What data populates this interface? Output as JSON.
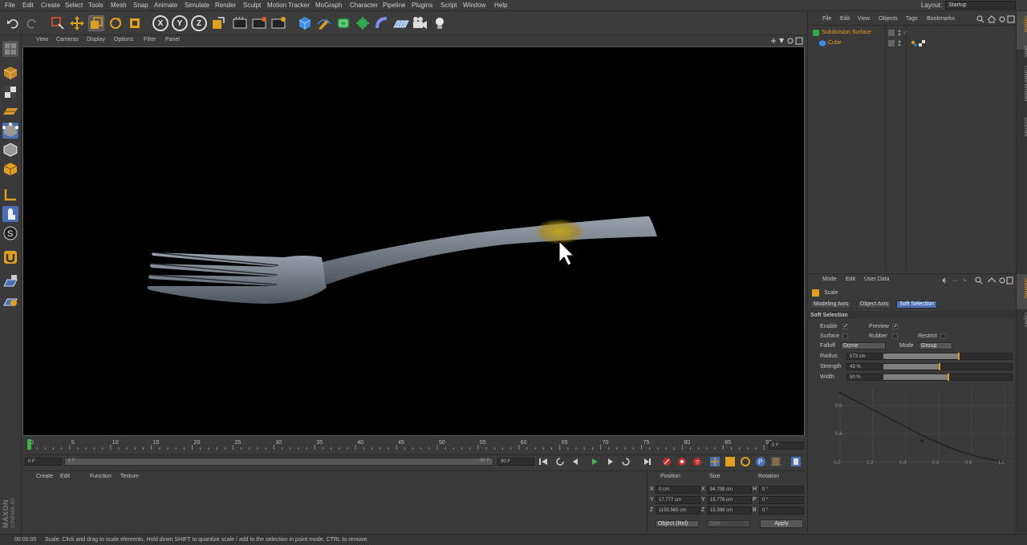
{
  "menu": [
    "File",
    "Edit",
    "Create",
    "Select",
    "Tools",
    "Mesh",
    "Snap",
    "Animate",
    "Simulate",
    "Render",
    "Sculpt",
    "Motion Tracker",
    "MoGraph",
    "Character",
    "Pipeline",
    "Plugins",
    "Script",
    "Window",
    "Help"
  ],
  "layout": {
    "label": "Layout:",
    "value": "Startup"
  },
  "toolbar_icons": [
    "undo-icon",
    "redo-icon",
    "live-selection-icon",
    "move-icon",
    "scale-icon",
    "rotate-icon",
    "recent-tool-icon",
    "x-axis-icon",
    "y-axis-icon",
    "z-axis-icon",
    "coordinate-system-icon",
    "render-view-icon",
    "render-picture-viewer-icon",
    "edit-render-settings-icon",
    "cube-icon",
    "pen-spline-icon",
    "subdivision-surface-icon",
    "array-icon",
    "deformer-icon",
    "floor-icon",
    "camera-icon",
    "light-icon"
  ],
  "axis_letters": {
    "x": "X",
    "y": "Y",
    "z": "Z"
  },
  "viewport_menu": [
    "View",
    "Cameras",
    "Display",
    "Options",
    "Filter",
    "Panel"
  ],
  "timeline": {
    "ticks": [
      "0",
      "5",
      "10",
      "15",
      "20",
      "25",
      "30",
      "35",
      "40",
      "45",
      "50",
      "55",
      "60",
      "65",
      "70",
      "75",
      "80",
      "85",
      "90"
    ],
    "end_field": "0 F",
    "current_frame": "0 F",
    "range_start": "0 F",
    "range_end": "90 F",
    "max_frame": "90 F"
  },
  "materials_menu": [
    "Create",
    "Edit",
    "Function",
    "Texture"
  ],
  "coords": {
    "headers": {
      "position": "Position",
      "size": "Size",
      "rotation": "Rotation"
    },
    "rows": [
      {
        "axis": "X",
        "pos": "0 cm",
        "size_axis": "X",
        "size": "94.708 cm",
        "rot_axis": "H",
        "rot": "0 °"
      },
      {
        "axis": "Y",
        "pos": "17.777 cm",
        "size_axis": "Y",
        "size": "15.778 cm",
        "rot_axis": "P",
        "rot": "0 °"
      },
      {
        "axis": "Z",
        "pos": "1150.565 cm",
        "size_axis": "Z",
        "size": "15.398 cm",
        "rot_axis": "B",
        "rot": "0 °"
      }
    ],
    "mode": "Object (Rel)",
    "size_mode": "Size",
    "apply": "Apply"
  },
  "maxon": {
    "brand": "MAXON",
    "product": "CINEMA 4D"
  },
  "status": {
    "time": "00:00:00",
    "message": "Scale: Click and drag to scale elements. Hold down SHIFT to quantize scale / add to the selection in point mode, CTRL to remove."
  },
  "object_manager": {
    "menu": [
      "File",
      "Edit",
      "View",
      "Objects",
      "Tags",
      "Bookmarks"
    ],
    "objects": [
      {
        "name": "Subdivision Surface",
        "color": "#e0a01e"
      },
      {
        "name": "Cube",
        "color": "#e0a01e"
      }
    ]
  },
  "right_tabs": [
    "Objects",
    "Takes",
    "Content Browser",
    "Structure"
  ],
  "right_tabs_lower": [
    "Attributes",
    "Layers"
  ],
  "attributes": {
    "menu": [
      "Mode",
      "Edit",
      "User Data"
    ],
    "tool_name": "Scale",
    "tabs": [
      "Modeling Axis",
      "Object Axis",
      "Soft Selection"
    ],
    "active_tab": "Soft Selection",
    "section": "Soft Selection",
    "enable": {
      "label": "Enable",
      "checked": true
    },
    "preview": {
      "label": "Preview",
      "checked": true
    },
    "surface": {
      "label": "Surface",
      "checked": false
    },
    "rubber": {
      "label": "Rubber",
      "checked": false
    },
    "restrict": {
      "label": "Restrict",
      "checked": false
    },
    "falloff": {
      "label": "Falloff",
      "value": "Dome"
    },
    "mode": {
      "label": "Mode",
      "value": "Group"
    },
    "radius": {
      "label": "Radius",
      "value": "573 cm",
      "fraction": 0.58
    },
    "strength": {
      "label": "Strength",
      "value": "43 %",
      "fraction": 0.43
    },
    "width": {
      "label": "Width",
      "value": "50 %",
      "fraction": 0.5
    },
    "graph_y_ticks": [
      "0.8",
      "0.4"
    ],
    "graph_x_ticks": [
      "0.0",
      "0.2",
      "0.4",
      "0.6",
      "0.8",
      "1.0"
    ]
  },
  "colors": {
    "accent": "#4a6fb5",
    "orange": "#d79a1a",
    "highlight": "#c8a418"
  }
}
